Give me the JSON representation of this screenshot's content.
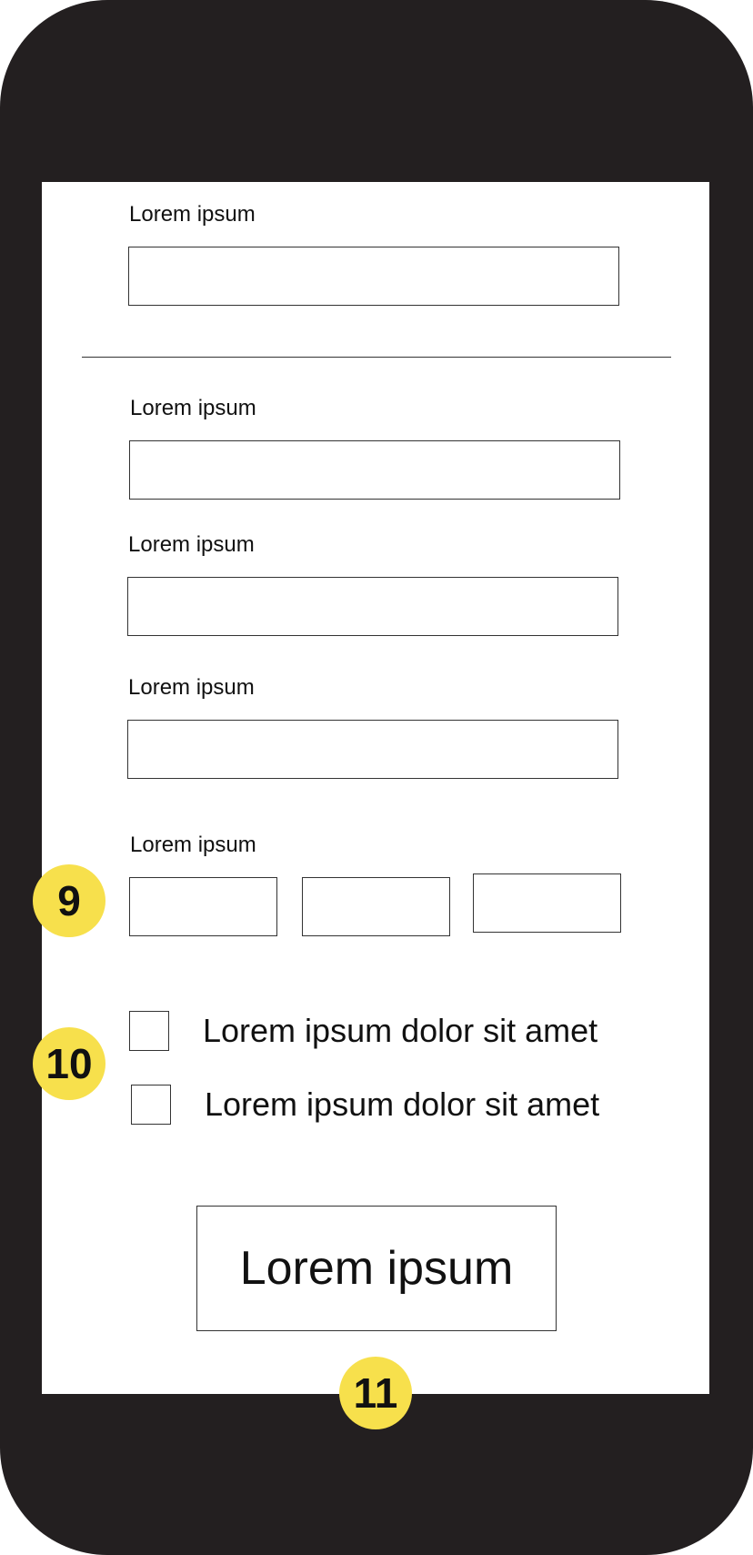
{
  "form": {
    "field1_label": "Lorem ipsum",
    "field2_label": "Lorem ipsum",
    "field3_label": "Lorem ipsum",
    "field4_label": "Lorem ipsum",
    "field5_label": "Lorem ipsum",
    "checkbox1_label": "Lorem ipsum dolor sit amet",
    "checkbox2_label": "Lorem ipsum dolor sit amet",
    "submit_label": "Lorem ipsum"
  },
  "annotations": {
    "marker_9": "9",
    "marker_10": "10",
    "marker_11": "11"
  },
  "colors": {
    "device_frame": "#231f20",
    "screen": "#ffffff",
    "annotation_marker": "#f7e04c"
  },
  "icons": {
    "annotation_marker": "teardrop-pin-icon"
  }
}
